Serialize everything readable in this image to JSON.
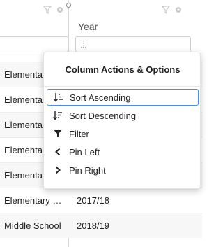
{
  "header": {
    "year_title": "Year",
    "icons": [
      "filter-icon",
      "gear-icon"
    ]
  },
  "menu": {
    "title": "Column Actions & Options",
    "items": [
      {
        "label": "Sort Ascending",
        "icon": "sort-ascending-icon",
        "selected": true
      },
      {
        "label": "Sort Descending",
        "icon": "sort-descending-icon",
        "selected": false
      },
      {
        "label": "Filter",
        "icon": "filter-icon",
        "selected": false
      },
      {
        "label": "Pin Left",
        "icon": "chevron-left-icon",
        "selected": false
      },
      {
        "label": "Pin Right",
        "icon": "chevron-right-icon",
        "selected": false
      }
    ]
  },
  "rows": [
    {
      "school": "Elementary",
      "year": ""
    },
    {
      "school": "Elementary",
      "year": ""
    },
    {
      "school": "Elementary",
      "year": ""
    },
    {
      "school": "Elementary",
      "year": ""
    },
    {
      "school": "Elementary",
      "year": ""
    },
    {
      "school": "Elementary School",
      "year": "2017/18"
    },
    {
      "school": "Middle School",
      "year": "2018/19"
    }
  ],
  "colors": {
    "accent_border": "#4a90e2",
    "row_alt": "#f7f7f7",
    "icon_muted": "#c9c9c9"
  }
}
